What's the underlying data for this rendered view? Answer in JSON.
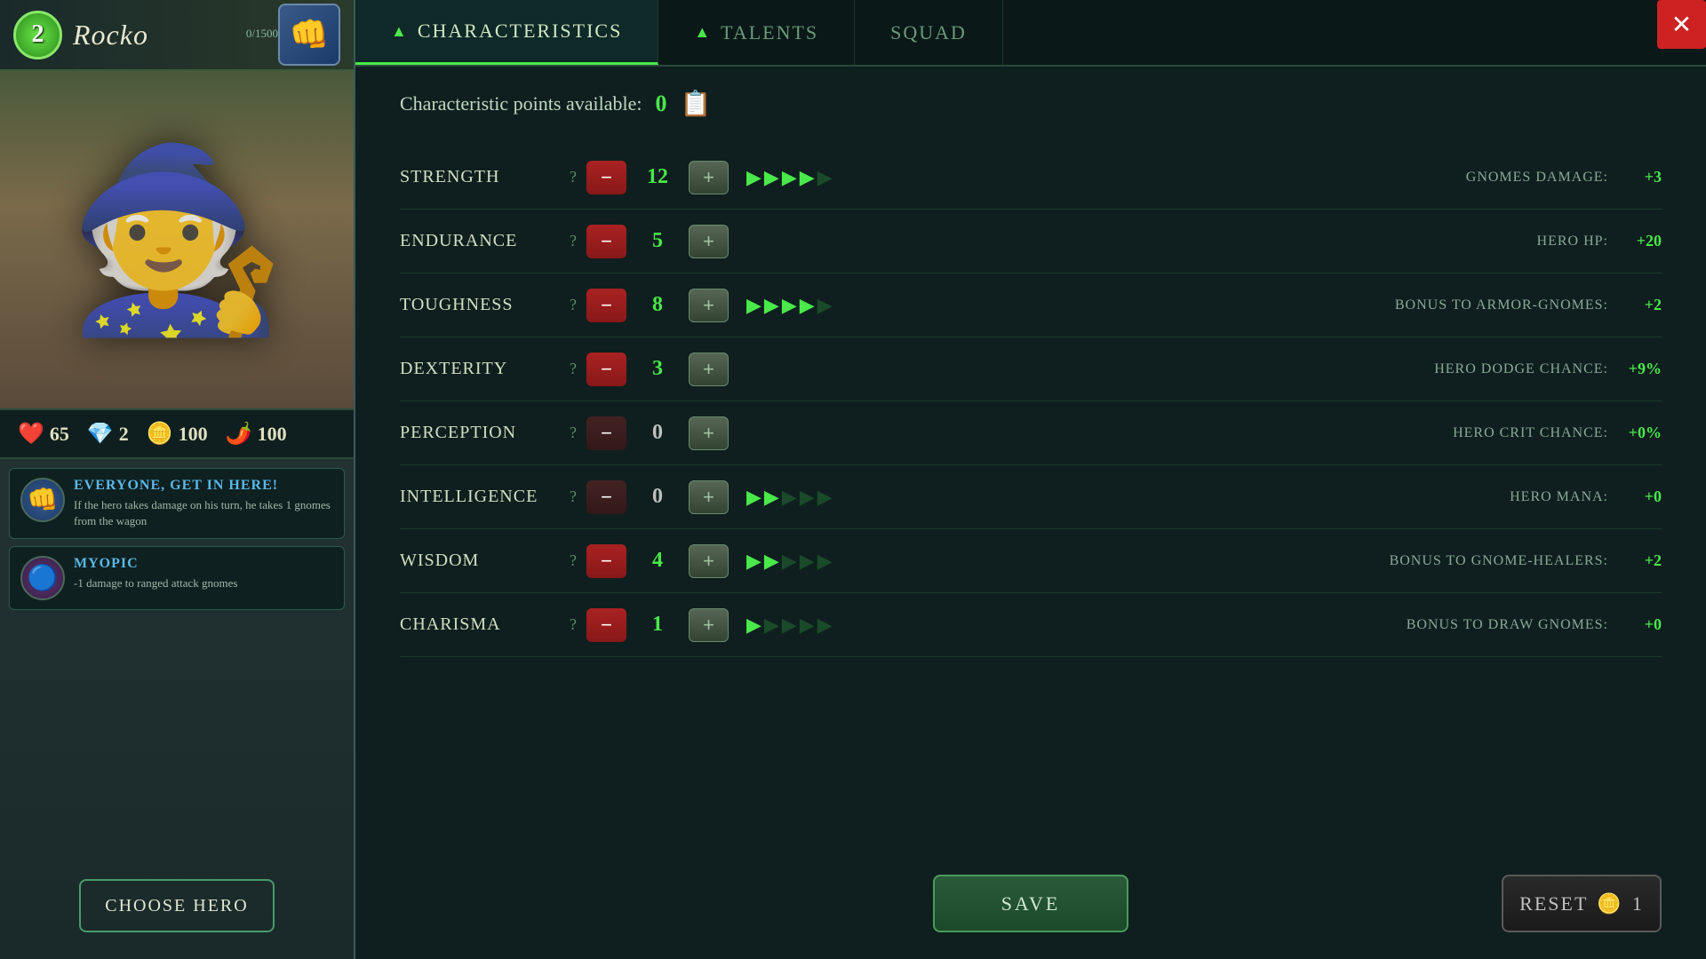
{
  "hero": {
    "name": "Rocko",
    "level": 2,
    "hp_current": 0,
    "hp_max": 1500,
    "hp_display": "0/1500",
    "stats": {
      "hearts": 65,
      "blue": 2,
      "gold": 100,
      "red": 100
    }
  },
  "tabs": {
    "characteristics": "Characteristics",
    "talents": "Talents",
    "squad": "Squad"
  },
  "points": {
    "label": "Characteristic points available:",
    "value": 0
  },
  "characteristics": [
    {
      "name": "Strength",
      "value": 12,
      "filled": 4,
      "total": 5,
      "bonus_label": "Gnomes damage:",
      "bonus_value": "+3",
      "minus_active": true
    },
    {
      "name": "Endurance",
      "value": 5,
      "filled": 0,
      "total": 0,
      "bonus_label": "Hero HP:",
      "bonus_value": "+20",
      "minus_active": true
    },
    {
      "name": "Toughness",
      "value": 8,
      "filled": 4,
      "total": 5,
      "bonus_label": "Bonus to armor-gnomes:",
      "bonus_value": "+2",
      "minus_active": true
    },
    {
      "name": "Dexterity",
      "value": 3,
      "filled": 0,
      "total": 0,
      "bonus_label": "Hero dodge chance:",
      "bonus_value": "+9%",
      "minus_active": true
    },
    {
      "name": "Perception",
      "value": 0,
      "filled": 0,
      "total": 0,
      "bonus_label": "Hero crit chance:",
      "bonus_value": "+0%",
      "minus_active": false
    },
    {
      "name": "Intelligence",
      "value": 0,
      "filled": 2,
      "total": 5,
      "bonus_label": "Hero mana:",
      "bonus_value": "+0",
      "minus_active": false
    },
    {
      "name": "Wisdom",
      "value": 4,
      "filled": 2,
      "total": 5,
      "bonus_label": "Bonus to gnome-healers:",
      "bonus_value": "+2",
      "minus_active": true
    },
    {
      "name": "Charisma",
      "value": 1,
      "filled": 1,
      "total": 5,
      "bonus_label": "Bonus to draw gnomes:",
      "bonus_value": "+0",
      "minus_active": true
    }
  ],
  "traits": [
    {
      "id": "everyone",
      "name": "Everyone, get in here!",
      "description": "If the hero takes damage on his turn, he takes 1 gnomes from the wagon"
    },
    {
      "id": "myopic",
      "name": "Myopic",
      "description": "-1 damage to ranged attack gnomes"
    }
  ],
  "buttons": {
    "choose_hero": "Choose Hero",
    "save": "Save",
    "reset": "Reset",
    "reset_count": 1
  },
  "close_label": "✕"
}
